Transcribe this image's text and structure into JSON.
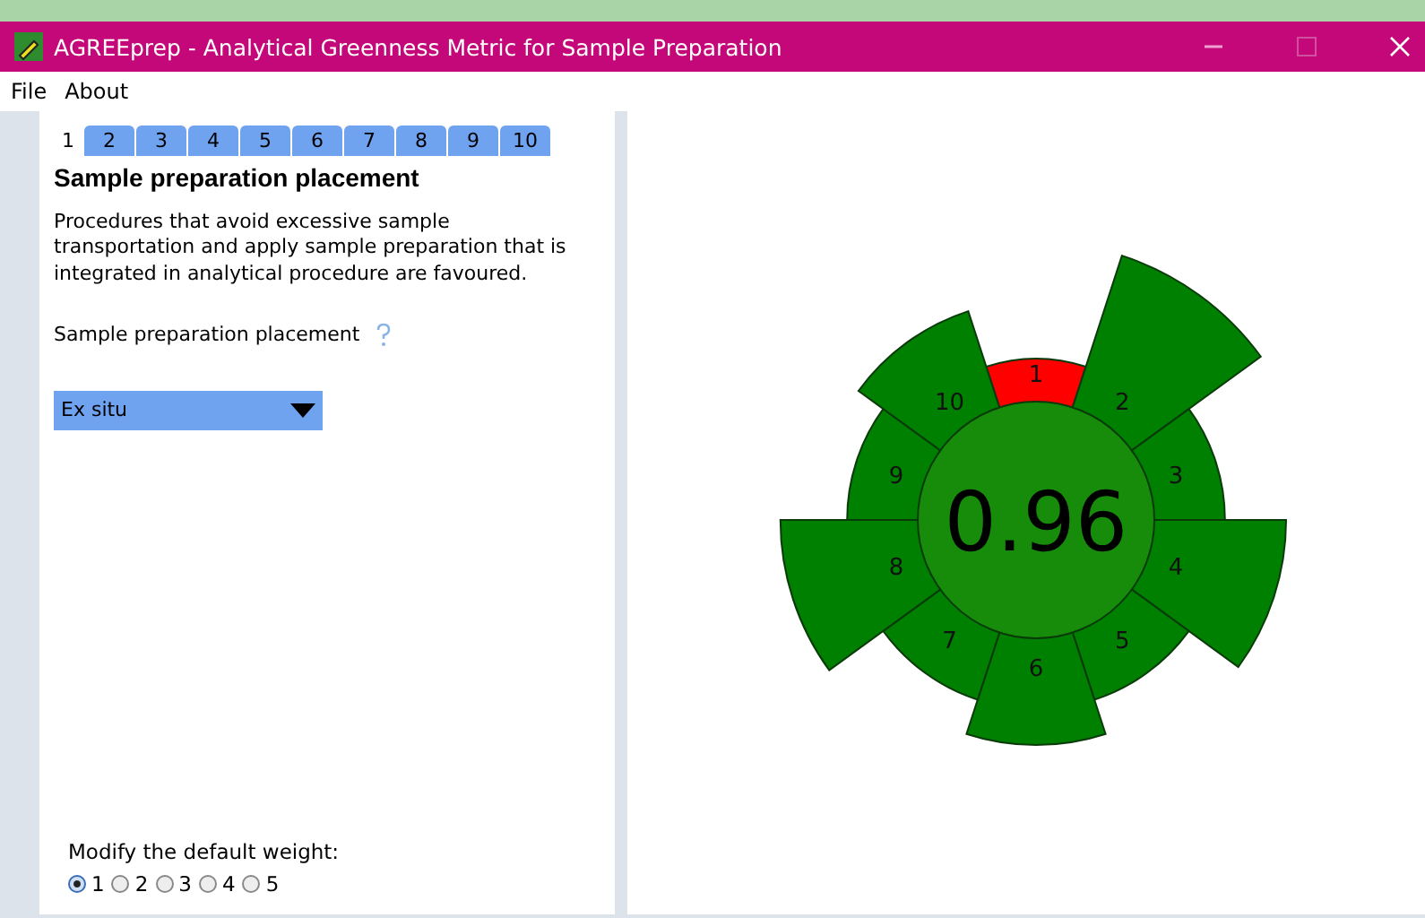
{
  "window": {
    "title": "AGREEprep - Analytical Greenness Metric for Sample Preparation"
  },
  "menu": [
    "File",
    "About"
  ],
  "tabs": [
    {
      "label": "1",
      "selected": true
    },
    {
      "label": "2",
      "selected": false
    },
    {
      "label": "3",
      "selected": false
    },
    {
      "label": "4",
      "selected": false
    },
    {
      "label": "5",
      "selected": false
    },
    {
      "label": "6",
      "selected": false
    },
    {
      "label": "7",
      "selected": false
    },
    {
      "label": "8",
      "selected": false
    },
    {
      "label": "9",
      "selected": false
    },
    {
      "label": "10",
      "selected": false
    }
  ],
  "panel": {
    "heading": "Sample preparation placement",
    "description": "Procedures that avoid excessive sample transportation and apply sample preparation that is integrated in analytical procedure are favoured.",
    "field_label": "Sample preparation placement",
    "dropdown": {
      "value": "Ex situ"
    },
    "weight_label": "Modify the default weight:",
    "weights": [
      {
        "label": "1",
        "selected": true
      },
      {
        "label": "2",
        "selected": false
      },
      {
        "label": "3",
        "selected": false
      },
      {
        "label": "4",
        "selected": false
      },
      {
        "label": "5",
        "selected": false
      }
    ]
  },
  "pictogram": {
    "score": "0.96",
    "segments": [
      {
        "label": "1",
        "color": "#ff0000"
      },
      {
        "label": "2",
        "color": "#008000"
      },
      {
        "label": "3",
        "color": "#008000"
      },
      {
        "label": "4",
        "color": "#008000"
      },
      {
        "label": "5",
        "color": "#008000"
      },
      {
        "label": "6",
        "color": "#008000"
      },
      {
        "label": "7",
        "color": "#008000"
      },
      {
        "label": "8",
        "color": "#008000"
      },
      {
        "label": "9",
        "color": "#008000"
      },
      {
        "label": "10",
        "color": "#008000"
      }
    ]
  }
}
